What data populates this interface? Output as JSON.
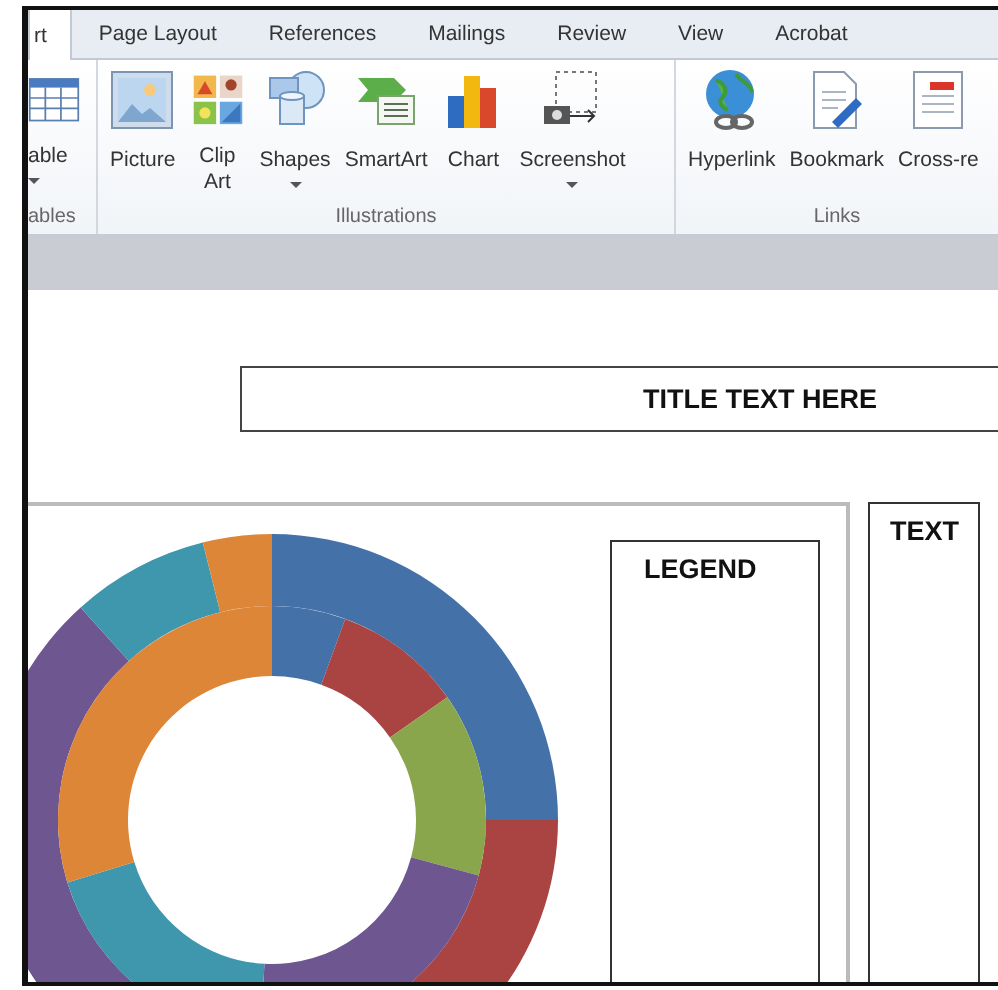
{
  "tabs": [
    {
      "label": "rt",
      "selected": true
    },
    {
      "label": "Page Layout",
      "selected": false
    },
    {
      "label": "References",
      "selected": false
    },
    {
      "label": "Mailings",
      "selected": false
    },
    {
      "label": "Review",
      "selected": false
    },
    {
      "label": "View",
      "selected": false
    },
    {
      "label": "Acrobat",
      "selected": false
    }
  ],
  "groups": [
    {
      "label": "ables",
      "buttons": [
        {
          "kind": "table",
          "label": "able",
          "dropdown": true
        }
      ]
    },
    {
      "label": "Illustrations",
      "buttons": [
        {
          "kind": "picture",
          "label": "Picture",
          "dropdown": false
        },
        {
          "kind": "clipart",
          "label": "Clip Art",
          "dropdown": false
        },
        {
          "kind": "shapes",
          "label": "Shapes",
          "dropdown": true
        },
        {
          "kind": "smartart",
          "label": "SmartArt",
          "dropdown": false
        },
        {
          "kind": "chart",
          "label": "Chart",
          "dropdown": false
        },
        {
          "kind": "screenshot",
          "label": "Screenshot",
          "dropdown": true
        }
      ]
    },
    {
      "label": "Links",
      "buttons": [
        {
          "kind": "hyperlink",
          "label": "Hyperlink",
          "dropdown": false
        },
        {
          "kind": "bookmark",
          "label": "Bookmark",
          "dropdown": false
        },
        {
          "kind": "crossref",
          "label": "Cross-re",
          "dropdown": false
        }
      ]
    }
  ],
  "document": {
    "title": "TITLE TEXT HERE",
    "legend": {
      "title": "LEGEND"
    },
    "text_box": {
      "title": "TEXT"
    }
  }
}
